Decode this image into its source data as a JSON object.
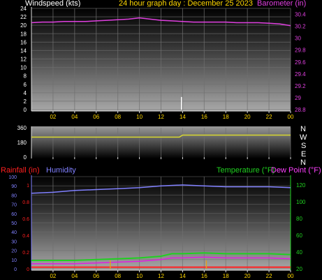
{
  "header": {
    "wind_label": "Windspeed (kts)",
    "title": "24 hour graph day : December 25 2023",
    "baro_label": "Barometer (in)"
  },
  "labels": {
    "rain": "Rainfall (in)",
    "humidity": "Humidity",
    "temperature": "Temperature (°F)",
    "dewpoint": "Dew Point (°F)",
    "compass": [
      "N",
      "W",
      "S",
      "E",
      "N"
    ]
  },
  "colors": {
    "wind": "#ffffff",
    "barometer": "#e040e0",
    "direction": "#d8d830",
    "rain": "#ff2020",
    "humidity": "#8080ff",
    "temperature": "#20d020",
    "dewpoint": "#e020e0",
    "title": "#ffd700",
    "axis_left_top": "#ffffff",
    "axis_right_top": "#e040e0",
    "axis_humidity": "#8080ff",
    "axis_rain": "#ff2020",
    "axis_temp": "#20d020",
    "x_ticks": "#ffd700"
  },
  "chart_data": [
    {
      "type": "line",
      "title": "24 hour graph day : December 25 2023",
      "xlabel": "",
      "x_ticks": [
        "02",
        "04",
        "06",
        "08",
        "10",
        "12",
        "14",
        "16",
        "18",
        "20",
        "22",
        "00"
      ],
      "x_range": [
        0,
        24
      ],
      "y_left": {
        "label": "Windspeed (kts)",
        "ticks": [
          0,
          2,
          4,
          6,
          8,
          10,
          12,
          14,
          16,
          18,
          20,
          22,
          24
        ],
        "range": [
          0,
          24
        ]
      },
      "y_right": {
        "label": "Barometer (in)",
        "ticks": [
          "28.8",
          "29",
          "29.2",
          "29.4",
          "29.6",
          "29.8",
          "30",
          "30.2",
          "30.4"
        ],
        "range": [
          28.8,
          30.5
        ]
      },
      "series": [
        {
          "name": "Barometer (in)",
          "axis": "right",
          "x": [
            0,
            1,
            2,
            3,
            4,
            5,
            6,
            7,
            8,
            9,
            10,
            11,
            12,
            13,
            14,
            15,
            16,
            17,
            18,
            19,
            20,
            21,
            22,
            23,
            24
          ],
          "values": [
            30.26,
            30.27,
            30.27,
            30.28,
            30.28,
            30.28,
            30.29,
            30.3,
            30.31,
            30.32,
            30.34,
            30.32,
            30.3,
            30.29,
            30.28,
            30.27,
            30.27,
            30.27,
            30.27,
            30.26,
            30.26,
            30.26,
            30.25,
            30.24,
            30.21
          ]
        },
        {
          "name": "Windspeed (kts)",
          "axis": "left",
          "x": [
            13.9
          ],
          "values": [
            3
          ]
        }
      ]
    },
    {
      "type": "line",
      "y_ticks": [
        0,
        180,
        360
      ],
      "range": [
        0,
        360
      ],
      "x_range": [
        0,
        24
      ],
      "x_ticks": [
        "02",
        "04",
        "06",
        "08",
        "10",
        "12",
        "14",
        "16",
        "18",
        "20",
        "22",
        "00"
      ],
      "series": [
        {
          "name": "Wind direction",
          "x": [
            0,
            13.7,
            14.0,
            24
          ],
          "values": [
            245,
            245,
            270,
            270
          ]
        }
      ]
    },
    {
      "type": "line",
      "x_range": [
        0,
        24
      ],
      "x_ticks": [
        "02",
        "04",
        "06",
        "08",
        "10",
        "12",
        "14",
        "16",
        "18",
        "20",
        "22",
        "00"
      ],
      "y_humidity": {
        "label": "Humidity",
        "ticks": [
          0,
          10,
          20,
          30,
          40,
          50,
          60,
          70,
          80,
          90,
          100
        ],
        "range": [
          0,
          100
        ]
      },
      "y_rain": {
        "label": "Rainfall (in)",
        "ticks": [
          "0",
          "0.2",
          "0.4",
          "0.6",
          "0.8",
          "1"
        ],
        "range": [
          0,
          1.1
        ]
      },
      "y_temp": {
        "label": "Temperature (°F)",
        "ticks": [
          20,
          40,
          60,
          80,
          100,
          120
        ],
        "range": [
          20,
          130
        ]
      },
      "series": [
        {
          "name": "Humidity",
          "axis": "humidity",
          "x": [
            0,
            2,
            4,
            6,
            8,
            10,
            12,
            14,
            16,
            18,
            20,
            22,
            24
          ],
          "values": [
            82,
            83,
            85,
            86,
            87,
            88,
            90,
            91,
            90,
            89,
            89,
            89,
            88
          ]
        },
        {
          "name": "Temperature (°F)",
          "axis": "temp",
          "x": [
            0,
            2,
            4,
            6,
            8,
            10,
            12,
            13,
            14,
            16,
            18,
            20,
            22,
            24
          ],
          "values": [
            30,
            30,
            30,
            31,
            32,
            33,
            35,
            38,
            38,
            39,
            38,
            38,
            38,
            37
          ]
        },
        {
          "name": "Dew Point (°F)",
          "axis": "temp",
          "x": [
            0,
            2,
            4,
            6,
            8,
            10,
            12,
            13,
            14,
            16,
            18,
            20,
            22,
            24
          ],
          "values": [
            26,
            26,
            26,
            27,
            28,
            29,
            31,
            33,
            33,
            34,
            33,
            33,
            33,
            32
          ]
        },
        {
          "name": "Rainfall (in)",
          "axis": "rain",
          "x": [
            0,
            24
          ],
          "values": [
            0.02,
            0.02
          ]
        },
        {
          "name": "Rain events",
          "axis": "rain",
          "kind": "bars",
          "x": [
            7.3,
            16.2
          ],
          "values": [
            0.1,
            0.1
          ]
        }
      ]
    }
  ]
}
